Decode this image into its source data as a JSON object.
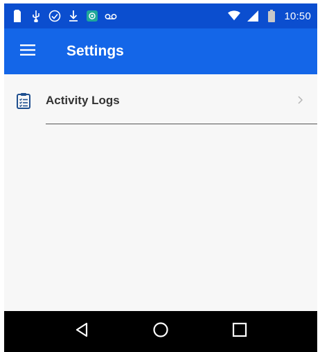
{
  "status_bar": {
    "time": "10:50",
    "icons_left": [
      "sim-card-icon",
      "usb-icon",
      "check-circle-icon",
      "download-icon",
      "app-notification-icon",
      "voicemail-icon"
    ],
    "icons_right": [
      "wifi-icon",
      "signal-icon",
      "battery-icon"
    ]
  },
  "app_bar": {
    "title": "Settings",
    "menu_icon": "menu-icon"
  },
  "settings_list": {
    "items": [
      {
        "label": "Activity Logs",
        "icon": "clipboard-list-icon",
        "trailing_icon": "chevron-right-icon"
      }
    ]
  },
  "nav_bar": {
    "buttons": [
      "back-icon",
      "home-icon",
      "recents-icon"
    ]
  },
  "colors": {
    "status_bar": "#0b4ecf",
    "app_bar": "#1466e8",
    "content_bg": "#f7f7f7",
    "nav_bar": "#000000",
    "accent_icon": "#1f4f8f"
  }
}
